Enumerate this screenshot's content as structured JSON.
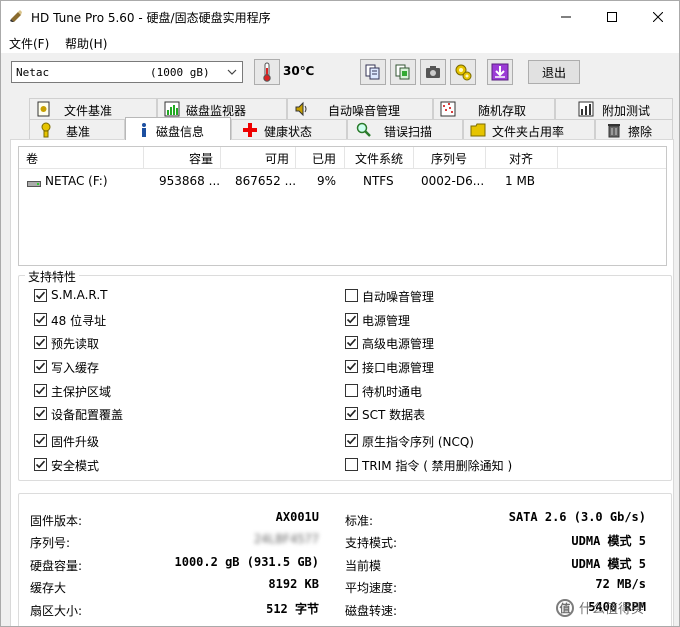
{
  "window": {
    "title": "HD Tune Pro 5.60 - 硬盘/固态硬盘实用程序"
  },
  "menu": {
    "file": "文件(F)",
    "help": "帮助(H)"
  },
  "toolbar": {
    "drive_name": "Netac",
    "drive_size": "(1000 gB)",
    "temperature": "30℃",
    "exit_label": "退出",
    "icons": [
      "copy-text-icon",
      "copy-screenshot-icon",
      "camera-icon",
      "options-icon",
      "download-icon"
    ]
  },
  "tabs": {
    "row1": [
      "文件基准",
      "磁盘监视器",
      "自动噪音管理",
      "随机存取",
      "附加测试"
    ],
    "row2": [
      "基准",
      "磁盘信息",
      "健康状态",
      "错误扫描",
      "文件夹占用率",
      "擦除"
    ],
    "active": "磁盘信息"
  },
  "volumes": {
    "columns": [
      "卷",
      "容量",
      "可用",
      "已用",
      "文件系统",
      "序列号",
      "对齐"
    ],
    "rows": [
      {
        "volume": "NETAC (F:)",
        "capacity": "953868 ...",
        "free": "867652 ...",
        "used": "9%",
        "fs": "NTFS",
        "serial": "0002-D6...",
        "align": "1 MB"
      }
    ]
  },
  "features": {
    "title": "支持特性",
    "left": [
      {
        "label": "S.M.A.R.T",
        "checked": true
      },
      {
        "label": "48 位寻址",
        "checked": true
      },
      {
        "label": "预先读取",
        "checked": true
      },
      {
        "label": "写入缓存",
        "checked": true
      },
      {
        "label": "主保护区域",
        "checked": true
      },
      {
        "label": "设备配置覆盖",
        "checked": true
      },
      {
        "label": "固件升级",
        "checked": true
      },
      {
        "label": "安全模式",
        "checked": true
      }
    ],
    "right": [
      {
        "label": "自动噪音管理",
        "checked": false
      },
      {
        "label": "电源管理",
        "checked": true
      },
      {
        "label": "高级电源管理",
        "checked": true
      },
      {
        "label": "接口电源管理",
        "checked": true
      },
      {
        "label": "待机时通电",
        "checked": false
      },
      {
        "label": "SCT 数据表",
        "checked": true
      },
      {
        "label": "原生指令序列 (NCQ)",
        "checked": true
      },
      {
        "label": "TRIM 指令 ( 禁用删除通知 )",
        "checked": false
      }
    ]
  },
  "info": {
    "firmware_label": "固件版本:",
    "firmware_value": "AX001U",
    "serial_label": "序列号:",
    "serial_value": "24LBF4577",
    "capacity_label": "硬盘容量:",
    "capacity_value": "1000.2 gB (931.5 GB)",
    "cache_label": "缓存大",
    "cache_value": "8192 KB",
    "sector_label": "扇区大小:",
    "sector_value": "512 字节",
    "standard_label": "标准:",
    "standard_value": "SATA 2.6 (3.0 Gb/s)",
    "supported_mode_label": "支持模式:",
    "supported_mode_value": "UDMA 模式 5",
    "current_mode_label": "当前模",
    "current_mode_value": "UDMA 模式 5",
    "avg_speed_label": "平均速度:",
    "avg_speed_value": "72 MB/s",
    "rpm_label": "磁盘转速:",
    "rpm_value": "5400 RPM"
  },
  "watermark": {
    "mark": "值",
    "text": "什么值得买"
  }
}
